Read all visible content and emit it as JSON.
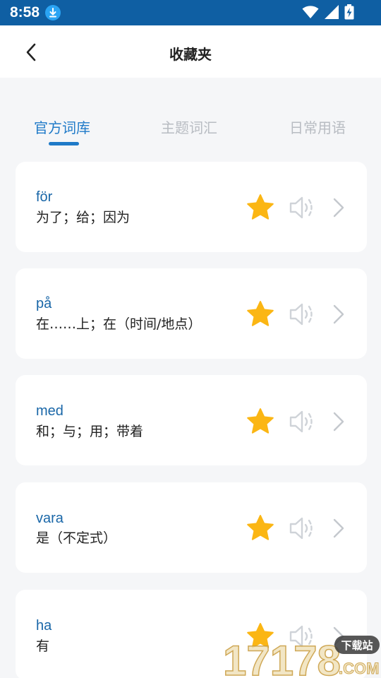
{
  "status": {
    "time": "8:58",
    "icons": [
      "download-icon",
      "wifi-icon",
      "signal-icon",
      "battery-charging-icon"
    ]
  },
  "nav": {
    "title": "收藏夹",
    "back_icon": "chevron-left-icon"
  },
  "tabs": [
    {
      "label": "官方词库",
      "active": true
    },
    {
      "label": "主题词汇",
      "active": false
    },
    {
      "label": "日常用语",
      "active": false
    }
  ],
  "items": [
    {
      "word": "för",
      "meaning": "为了；给；因为"
    },
    {
      "word": "på",
      "meaning": "在……上；在（时间/地点）"
    },
    {
      "word": "med",
      "meaning": "和；与；用；带着"
    },
    {
      "word": "vara",
      "meaning": "是（不定式）"
    },
    {
      "word": "ha",
      "meaning": "有"
    }
  ],
  "colors": {
    "status_bar": "#0f5fa3",
    "accent": "#1f7ac8",
    "star": "#fbb614",
    "word": "#1a67a8"
  },
  "watermark": {
    "number": "17178",
    "badge": "下载站",
    "domain": ".COM"
  }
}
